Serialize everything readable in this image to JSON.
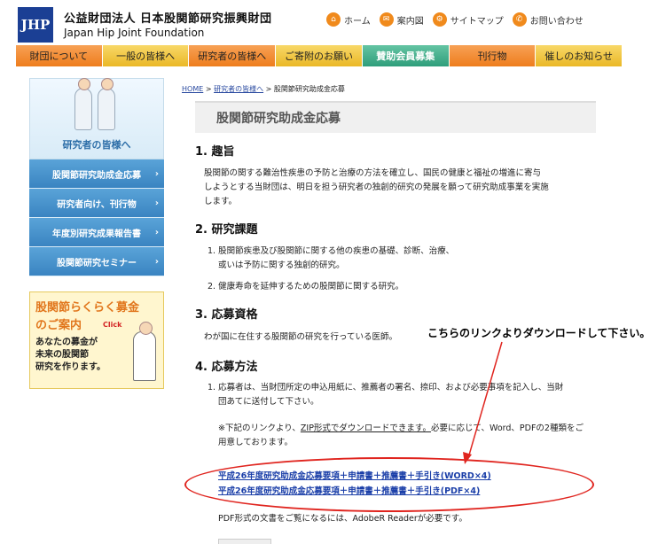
{
  "header": {
    "logo_text": "JHP",
    "org_name_jp": "公益財団法人 日本股関節研究振興財団",
    "org_name_en": "Japan Hip Joint Foundation",
    "top_links": [
      "ホーム",
      "案内図",
      "サイトマップ",
      "お問い合わせ"
    ]
  },
  "nav": {
    "items": [
      "財団について",
      "一般の皆様へ",
      "研究者の皆様へ",
      "ご寄附のお願い",
      "賛助会員募集",
      "刊行物",
      "催しのお知らせ"
    ]
  },
  "sidebar": {
    "title": "研究者の皆様へ",
    "items": [
      "股関節研究助成金応募",
      "研究者向け、刊行物",
      "年度別研究成果報告書",
      "股関節研究セミナー"
    ],
    "banner_line1": "股関節らくらく募金",
    "banner_line2": "のご案内",
    "banner_click": "Click",
    "banner_line3": "あなたの募金が",
    "banner_line4": "未来の股関節",
    "banner_line5": "研究を作ります。"
  },
  "breadcrumb": {
    "home": "HOME",
    "parent": "研究者の皆様へ",
    "current": "股関節研究助成金応募"
  },
  "content": {
    "title": "股関節研究助成金応募",
    "s1_heading": "1. 趣旨",
    "s1_line1": "股関節の関する難治性疾患の予防と治療の方法を確立し、国民の健康と福祉の増進に寄与",
    "s1_line2": "しようとする当財団は、明日を担う研究者の独創的研究の発展を願って研究助成事業を実施",
    "s1_line3": "します。",
    "s2_heading": "2. 研究課題",
    "s2_item1a": "1. 股関節疾患及び股関節に関する他の疾患の基礎、診断、治療、",
    "s2_item1b": "或いは予防に関する独創的研究。",
    "s2_item2": "2. 健康寿命を延伸するための股関節に関する研究。",
    "s3_heading": "3. 応募資格",
    "s3_text": "わが国に在住する股関節の研究を行っている医師。",
    "s4_heading": "4. 応募方法",
    "s4_item1a": "1. 応募者は、当財団所定の申込用紙に、推薦者の署名、捺印、および必要事項を記入し、当財",
    "s4_item1b": "団あてに送付して下さい。",
    "note_a_pre": "※下記のリンクより、",
    "note_a_link": "ZIP形式でダウンロードできます。",
    "note_a_post": "必要に応じて、Word、PDFの2種類をご",
    "note_b": "用意しております。",
    "link_word": "平成26年度研究助成金応募要項＋申請書＋推薦書＋手引き(WORD×4)",
    "link_pdf": "平成26年度研究助成金応募要項＋申請書＋推薦書＋手引き(PDF×4)",
    "pdf_note": "PDF形式の文書をご覧になるには、AdobeR Readerが必要です。"
  },
  "annotation": {
    "text": "こちらのリンクよりダウンロードして下さい。",
    "color": "#e0251f"
  }
}
